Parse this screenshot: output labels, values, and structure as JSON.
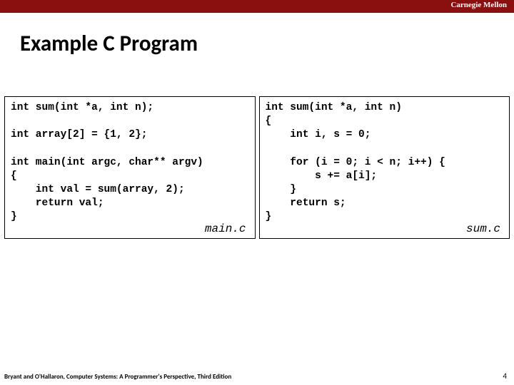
{
  "header": {
    "institution": "Carnegie Mellon"
  },
  "title": "Example C Program",
  "code_left": "int sum(int *a, int n);\n\nint array[2] = {1, 2};\n\nint main(int argc, char** argv)\n{\n    int val = sum(array, 2);\n    return val;\n}",
  "code_right": "int sum(int *a, int n)\n{\n    int i, s = 0;\n\n    for (i = 0; i < n; i++) {\n        s += a[i];\n    }\n    return s;\n}",
  "filenames": {
    "left": "main.c",
    "right": "sum.c"
  },
  "footer": {
    "reference": "Bryant and O'Hallaron, Computer Systems: A Programmer's Perspective, Third Edition",
    "page_number": "4"
  }
}
